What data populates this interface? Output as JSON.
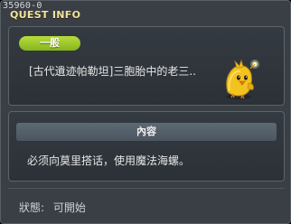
{
  "window": {
    "quest_id": "35960-0",
    "title": "QUEST INFO"
  },
  "quest": {
    "category": "一般",
    "name": "[古代遺迹帕勒坦]三胞胎中的老三..",
    "npc_icon": "yellow-bird-npc-icon"
  },
  "content": {
    "header": "內容",
    "text": "必须向莫里搭话，使用魔法海螺。"
  },
  "status": {
    "label": "狀態:",
    "value": "可開始"
  },
  "colors": {
    "title": "#f2e49a",
    "badge_green": "#9ccb2c",
    "panel_bg": "#2c3137",
    "window_bg": "#3a3f45"
  }
}
